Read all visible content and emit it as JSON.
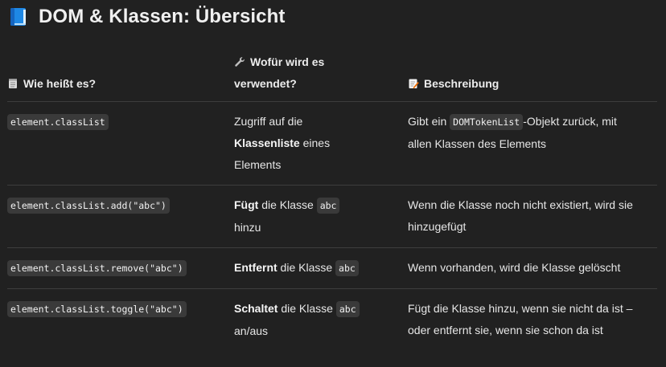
{
  "title": "DOM & Klassen: Übersicht",
  "header": {
    "col1": "Wie heißt es?",
    "col2_line1": "Wofür wird es",
    "col2_line2": "verwendet?",
    "col3": "Beschreibung"
  },
  "icons": {
    "title": "blue-book-icon",
    "col1": "notepad-icon",
    "col2": "wrench-icon",
    "col3": "memo-icon"
  },
  "rows": [
    {
      "code": "element.classList",
      "use": {
        "a": "Zugriff auf die",
        "b": "Klassenliste",
        "c": " eines",
        "d": "Elements"
      },
      "desc": {
        "a": "Gibt ein ",
        "code": "DOMTokenList",
        "b": "-Objekt zurück, mit",
        "c": "allen Klassen des Elements"
      }
    },
    {
      "code": "element.classList.add(\"abc\")",
      "use": {
        "bold": "Fügt",
        "text": " die Klasse ",
        "code": "abc",
        "tail": "hinzu"
      },
      "desc": {
        "a": "Wenn die Klasse noch nicht existiert, wird sie",
        "b": "hinzugefügt"
      }
    },
    {
      "code": "element.classList.remove(\"abc\")",
      "use": {
        "bold": "Entfernt",
        "text": " die Klasse ",
        "code": "abc"
      },
      "desc": {
        "a": "Wenn vorhanden, wird die Klasse gelöscht"
      }
    },
    {
      "code": "element.classList.toggle(\"abc\")",
      "use": {
        "bold": "Schaltet",
        "text": " die Klasse ",
        "code": "abc",
        "tail": "an/aus"
      },
      "desc": {
        "a": "Fügt die Klasse hinzu, wenn sie nicht da ist –",
        "b": "oder entfernt sie, wenn sie schon da ist"
      }
    }
  ]
}
